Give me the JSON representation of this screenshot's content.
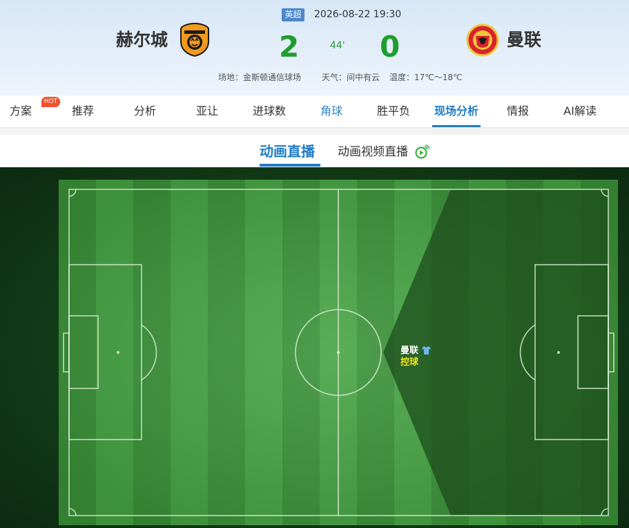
{
  "match": {
    "league": "英超",
    "datetime": "2026-08-22 19:30",
    "minute": "44'",
    "home": {
      "name": "赫尔城",
      "score": "2",
      "logo_icon": "hull-city-crest-icon"
    },
    "away": {
      "name": "曼联",
      "score": "0",
      "logo_icon": "manchester-united-crest-icon"
    },
    "venue": "场地：金斯顿通信球场",
    "weather": "天气：间中有云",
    "temperature": "温度：17℃～18℃"
  },
  "tabs": [
    {
      "label": "方案",
      "badge": "HOT"
    },
    {
      "label": "推荐"
    },
    {
      "label": "分析"
    },
    {
      "label": "亚让"
    },
    {
      "label": "进球数"
    },
    {
      "label": "角球"
    },
    {
      "label": "胜平负"
    },
    {
      "label": "现场分析",
      "active": true
    },
    {
      "label": "情报"
    },
    {
      "label": "AI解读"
    }
  ],
  "subtabs": {
    "active": "动画直播",
    "video": "动画视频直播",
    "video_icon": "live-broadcast-icon"
  },
  "field": {
    "possession_team": "曼联",
    "possession_status": "控球",
    "shirt_icon": "blue-shirt-icon"
  },
  "colors": {
    "accent": "#1f7cc6",
    "score": "#1f9d2f",
    "hot": "#f0522f",
    "pitch_light": "#46a443",
    "pitch_dark": "#3a9238",
    "attack_shade": "#2d6b2a",
    "possession_status": "#f4e51c"
  }
}
